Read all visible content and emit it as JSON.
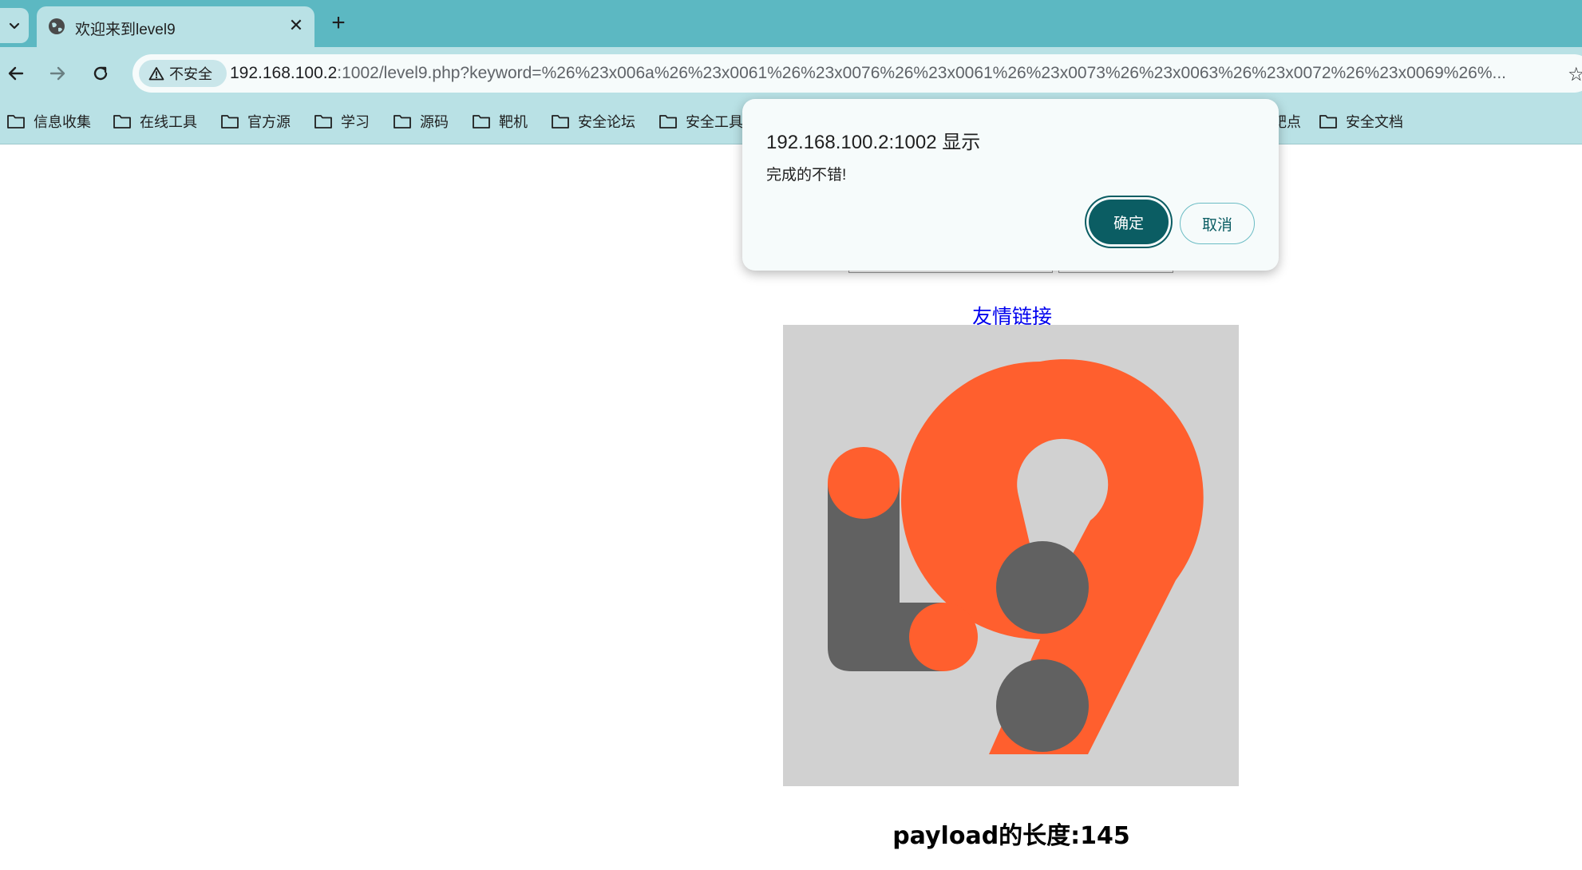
{
  "browser": {
    "tab": {
      "title": "欢迎来到level9",
      "close_glyph": "✕"
    },
    "new_tab_glyph": "+",
    "security_label": "不安全",
    "url_host": "192.168.100.2",
    "url_rest": ":1002/level9.php?keyword=%26%23x006a%26%23x0061%26%23x0076%26%23x0061%26%23x0073%26%23x0063%26%23x0072%26%23x0069%26%...",
    "bookmarks": [
      "信息收集",
      "在线工具",
      "官方源",
      "学习",
      "源码",
      "靶机",
      "安全论坛",
      "安全工具",
      "靶点",
      "安全文档"
    ]
  },
  "page": {
    "friend_link": "友情链接",
    "payload_length": "payload的长度:145"
  },
  "dialog": {
    "title": "192.168.100.2:1002 显示",
    "message": "完成的不错!",
    "ok_label": "确定",
    "cancel_label": "取消"
  },
  "colors": {
    "tabstrip": "#5cb8c2",
    "toolbar": "#b9e1e5",
    "logo_orange": "#ff5f2e",
    "logo_gray": "#616161",
    "logo_bg": "#d1d1d1",
    "dialog_ok": "#0b5d63"
  }
}
